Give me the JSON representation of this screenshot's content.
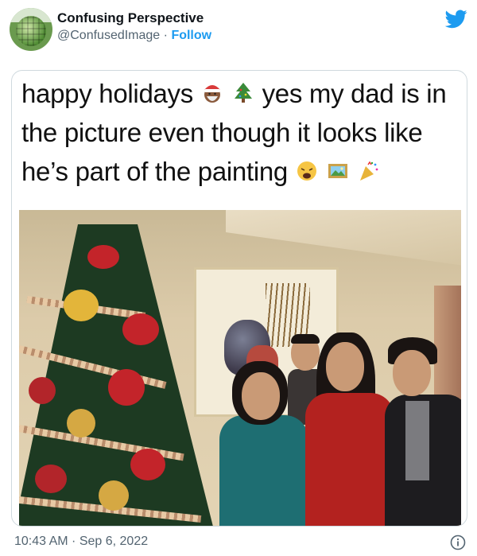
{
  "tweet": {
    "display_name": "Confusing Perspective",
    "handle": "@ConfusedImage",
    "separator": "·",
    "follow_label": "Follow",
    "timestamp": "10:43 AM · Sep 6, 2022"
  },
  "meme": {
    "caption_part1": "happy holidays",
    "caption_part2": "yes my dad is in the picture even though it looks like he’s part of the painting"
  },
  "icons": {
    "brand": "twitter-bird-icon",
    "info": "info-icon",
    "emojis": [
      "santa-emoji",
      "christmas-tree-emoji",
      "weary-face-emoji",
      "framed-picture-emoji",
      "party-popper-emoji"
    ]
  },
  "colors": {
    "link": "#1d9bf0",
    "secondary_text": "#536471",
    "primary_text": "#0f1419",
    "border": "#cfd9de"
  }
}
